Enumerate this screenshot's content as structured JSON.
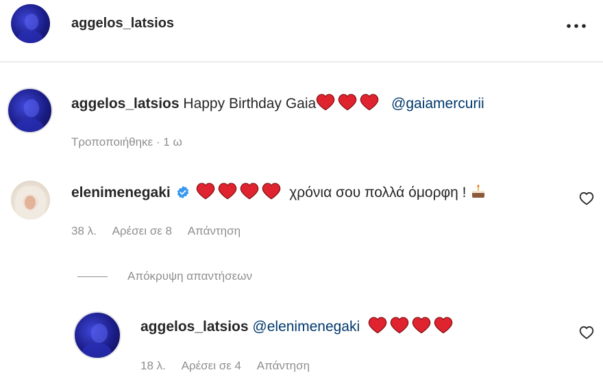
{
  "header": {
    "username": "aggelos_latsios",
    "more_icon": "more-horizontal-icon"
  },
  "caption": {
    "username": "aggelos_latsios",
    "text": "Happy Birthday Gaia",
    "hearts": 3,
    "mention": "@gaiamercurii",
    "edited_label": "Τροποποιήθηκε",
    "separator": "·",
    "time": "1 ω"
  },
  "comments": [
    {
      "username": "elenimenegaki",
      "verified": true,
      "hearts": 4,
      "text": "χρόνια σου πολλά όμορφη !",
      "emoji": "cake-icon",
      "time": "38 λ.",
      "likes": "Αρέσει σε 8",
      "reply": "Απάντηση",
      "hide_replies": "Απόκρυψη απαντήσεων",
      "replies": [
        {
          "username": "aggelos_latsios",
          "mention": "@elenimenegaki",
          "hearts": 4,
          "time": "18 λ.",
          "likes": "Αρέσει σε 4",
          "reply": "Απάντηση"
        }
      ]
    }
  ],
  "colors": {
    "heart": "#e0242f",
    "mention": "#00376b",
    "verified": "#3897f0",
    "muted": "#8e8e8e"
  }
}
